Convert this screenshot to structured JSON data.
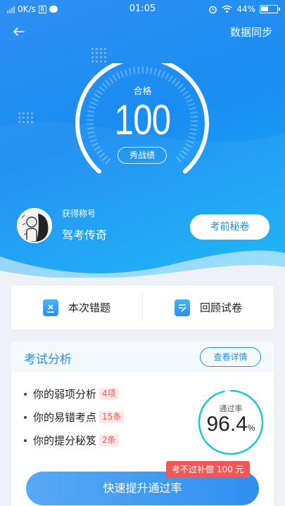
{
  "status_bar": {
    "speed": "0K/s",
    "box_label": "B",
    "time": "01:05",
    "battery": "44%"
  },
  "header": {
    "sync_label": "数据同步"
  },
  "score": {
    "caption": "合格",
    "value": "100",
    "show_label": "秀战绩"
  },
  "user": {
    "title_caption": "获得称号",
    "title_name": "驾考传奇",
    "secret_button": "考前秘卷"
  },
  "actions": [
    {
      "label": "本次错题",
      "icon": "wrong-questions-icon"
    },
    {
      "label": "回顾试卷",
      "icon": "review-paper-icon"
    }
  ],
  "analysis": {
    "title": "考试分析",
    "detail_button": "查看详情",
    "items": [
      {
        "label": "你的弱项分析",
        "tag": "4项"
      },
      {
        "label": "你的易错考点",
        "tag": "15条"
      },
      {
        "label": "你的提分秘笈",
        "tag": "2条"
      }
    ],
    "rate_caption": "通过率",
    "rate_value": "96.4",
    "rate_unit": "%",
    "rate_fraction": 0.964
  },
  "promo": {
    "button_label": "快速提升通过率",
    "badge": "考不过补偿 100 元"
  },
  "colors": {
    "primary": "#1e8ff0",
    "tag_red": "#f25a5a",
    "ring_cyan": "#22c4d6"
  }
}
